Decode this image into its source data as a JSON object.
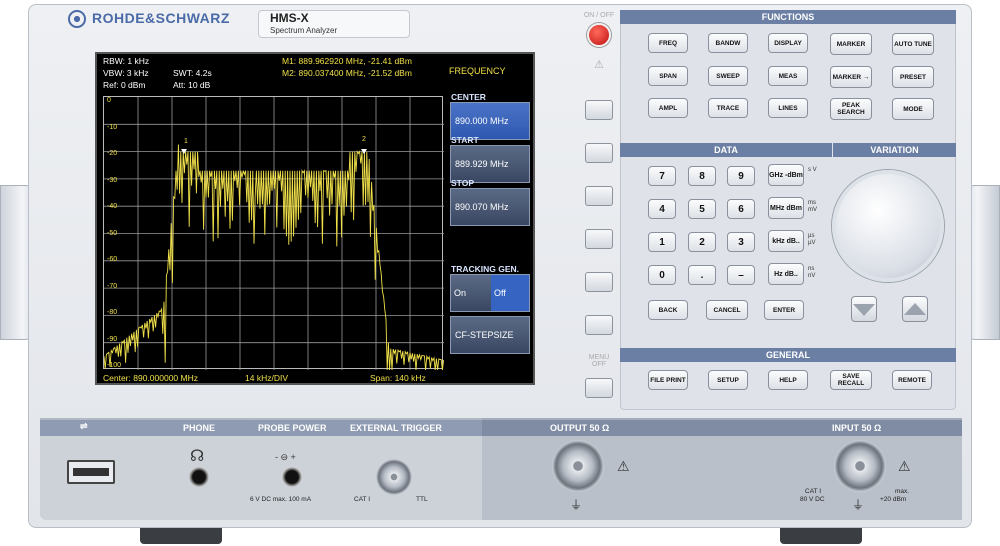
{
  "device": {
    "brand": "ROHDE&SCHWARZ",
    "model": "HMS-X",
    "model_subtitle": "Spectrum Analyzer"
  },
  "screen": {
    "rbw": "RBW: 1 kHz",
    "vbw": "VBW: 3 kHz",
    "swt": "SWT: 4.2s",
    "ref": "Ref: 0 dBm",
    "att": "Att: 10 dB",
    "marker1": "M1: 889.962920 MHz, -21.41 dBm",
    "marker2": "M2: 890.037400 MHz, -21.52 dBm",
    "menu_title": "FREQUENCY",
    "center_footer": "Center: 890.000000 MHz",
    "div_footer": "14 kHz/DIV",
    "span_footer": "Span: 140 kHz",
    "y_ticks": [
      "0",
      "-10",
      "-20",
      "-30",
      "-40",
      "-50",
      "-60",
      "-70",
      "-80",
      "-90",
      "-100"
    ],
    "marker_labels": [
      "1",
      "2"
    ],
    "softkeys": [
      {
        "title": "CENTER",
        "value": "890.000 MHz"
      },
      {
        "title": "START",
        "value": "889.929 MHz"
      },
      {
        "title": "STOP",
        "value": "890.070 MHz"
      },
      {
        "title": "TRACKING GEN.",
        "value_on": "On",
        "value_off": "Off"
      },
      {
        "title": "",
        "value": "CF-STEPSIZE"
      }
    ],
    "trace_color": "#f0e04a"
  },
  "power": {
    "label": "ON / OFF"
  },
  "menu_off": {
    "label1": "MENU",
    "label2": "OFF"
  },
  "functions": {
    "title": "FUNCTIONS",
    "buttons": [
      [
        "FREQ",
        "BANDW",
        "DISPLAY",
        "MARKER",
        "AUTO TUNE"
      ],
      [
        "SPAN",
        "SWEEP",
        "MEAS",
        "MARKER →",
        "PRESET"
      ],
      [
        "AMPL",
        "TRACE",
        "LINES",
        "PEAK SEARCH",
        "MODE"
      ]
    ]
  },
  "data_section": {
    "title": "DATA",
    "digits": [
      [
        "7",
        "8",
        "9"
      ],
      [
        "4",
        "5",
        "6"
      ],
      [
        "1",
        "2",
        "3"
      ],
      [
        "0",
        ".",
        "–"
      ]
    ],
    "units": [
      {
        "key": "GHz -dBm",
        "side": "s V"
      },
      {
        "key": "MHz dBm",
        "side": "ms mV"
      },
      {
        "key": "kHz dB..",
        "side": "µs µV"
      },
      {
        "key": "Hz dB..",
        "side": "ns nV"
      }
    ],
    "actions": [
      "BACK",
      "CANCEL",
      "ENTER"
    ]
  },
  "variation": {
    "title": "VARIATION"
  },
  "general": {
    "title": "GENERAL",
    "buttons": [
      "FILE PRINT",
      "SETUP",
      "HELP",
      "SAVE RECALL",
      "REMOTE"
    ]
  },
  "bottom": {
    "usb": "⇌",
    "phone": "PHONE",
    "probe_power": "PROBE POWER",
    "probe_spec": "6 V DC max. 100 mA",
    "ext_trigger": "EXTERNAL TRIGGER",
    "cat_i": "CAT I",
    "ttl": "TTL",
    "output": "OUTPUT 50 Ω",
    "input": "INPUT 50 Ω",
    "input_cat": "CAT I",
    "input_v": "80 V DC",
    "input_max": "max.",
    "input_dbm": "+20 dBm"
  }
}
